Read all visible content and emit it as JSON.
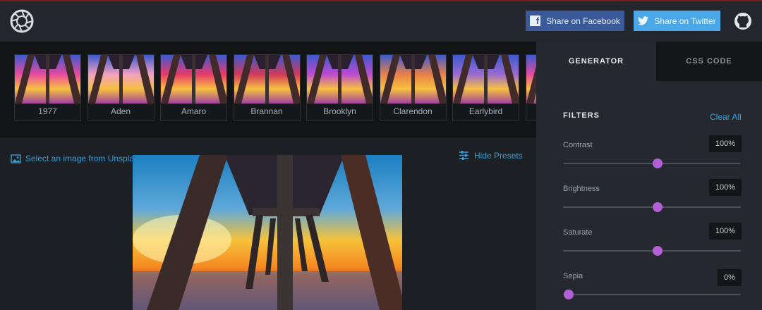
{
  "header": {
    "share_facebook": "Share on Facebook",
    "share_twitter": "Share on Twitter",
    "colors": {
      "facebook": "#3b5a99",
      "twitter": "#4aa8e8",
      "accent": "#3aa0d8",
      "slider": "#b35fd6"
    }
  },
  "presets": [
    "1977",
    "Aden",
    "Amaro",
    "Brannan",
    "Brooklyn",
    "Clarendon",
    "Earlybird"
  ],
  "main": {
    "select_image": "Select an image from Unspla",
    "hide_presets": "Hide Presets"
  },
  "panel": {
    "tabs": [
      "GENERATOR",
      "CSS CODE"
    ],
    "active_tab": "GENERATOR",
    "filters_title": "FILTERS",
    "clear_all": "Clear All",
    "filters": [
      {
        "label": "Contrast",
        "value": "100%",
        "level": 0.5
      },
      {
        "label": "Brightness",
        "value": "100%",
        "level": 0.5
      },
      {
        "label": "Saturate",
        "value": "100%",
        "level": 0.5
      },
      {
        "label": "Sepia",
        "value": "0%",
        "level": 0.0
      }
    ]
  }
}
